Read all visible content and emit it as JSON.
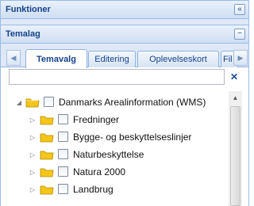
{
  "panels": {
    "funktioner": {
      "title": "Funktioner",
      "collapse_icon": "double-chevron-left-icon"
    },
    "temalag": {
      "title": "Temalag",
      "minimize_icon": "minus-icon"
    }
  },
  "tabs": [
    {
      "label": "Temavalg",
      "active": true
    },
    {
      "label": "Editering",
      "active": false
    },
    {
      "label": "Oplevelseskort",
      "active": false
    },
    {
      "label": "Fil",
      "active": false
    }
  ],
  "search": {
    "value": "",
    "placeholder": "",
    "clear_icon": "close-icon"
  },
  "tree": {
    "root": {
      "label": "Danmarks Arealinformation (WMS)",
      "expanded": true,
      "checked": false
    },
    "children": [
      {
        "label": "Fredninger",
        "checked": false
      },
      {
        "label": "Bygge- og beskyttelseslinjer",
        "checked": false
      },
      {
        "label": "Naturbeskyttelse",
        "checked": false
      },
      {
        "label": "Natura 2000",
        "checked": false
      },
      {
        "label": "Landbrug",
        "checked": false
      }
    ]
  },
  "colors": {
    "header_text": "#15428b",
    "border": "#99bbe8",
    "folder": "#f5c518"
  }
}
